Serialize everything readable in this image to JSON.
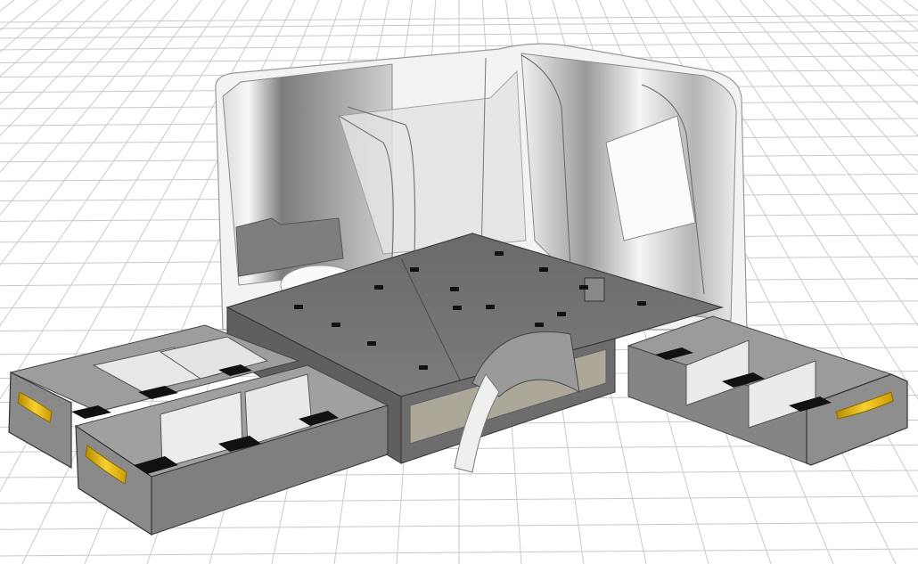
{
  "scene": {
    "view": "cad-3d-perspective",
    "subject": "van-cargo-floor-with-drawer-units",
    "background_color": "#ffffff",
    "grid_color": "#c9c9c9",
    "shell_color": "#ececec",
    "floor_panel_color": "#707070",
    "drawer_box_color": "#8c8c8c",
    "drawer_interior_color": "#9a9a9a",
    "divider_color": "#e6e6e6",
    "slot_color": "#111111",
    "handle_color": "#f2c21b",
    "drawers_open": 3,
    "compartments_per_drawer": 3
  }
}
